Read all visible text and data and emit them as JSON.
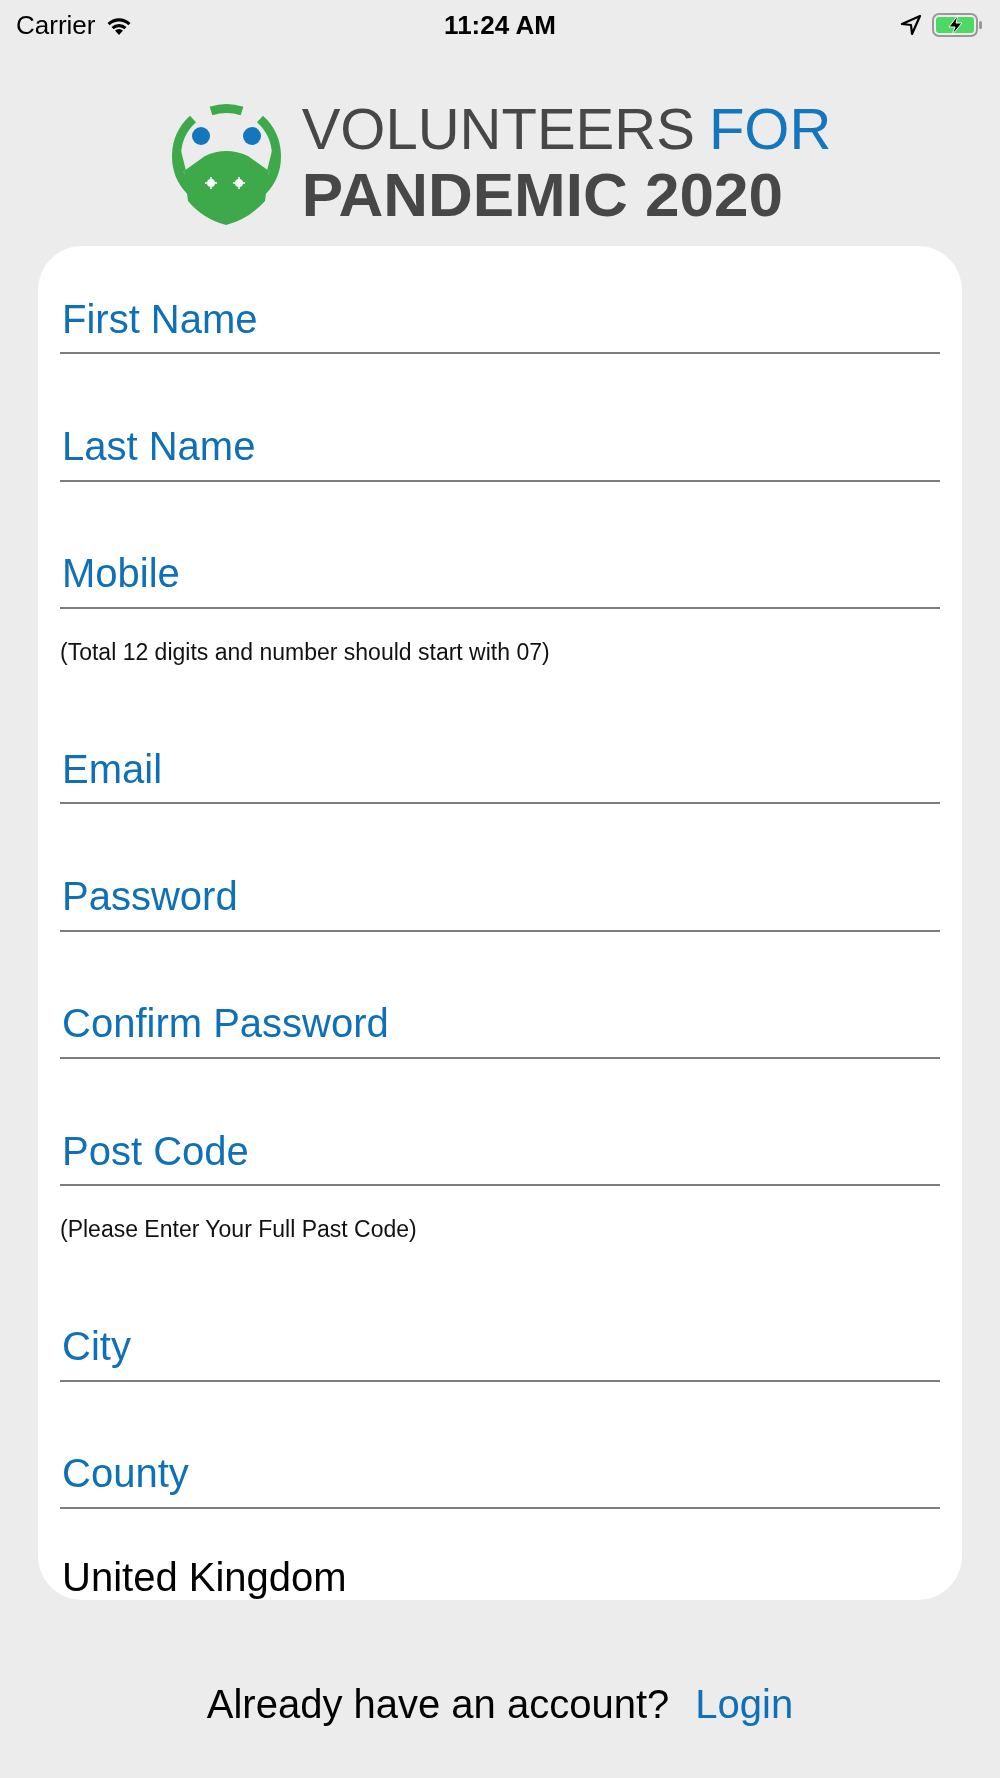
{
  "status_bar": {
    "carrier": "Carrier",
    "time": "11:24 AM"
  },
  "logo": {
    "line1": [
      {
        "text": "VOLUNTEERS",
        "accent": false
      },
      {
        "text": "FOR",
        "accent": true
      }
    ],
    "line2": "PANDEMIC 2020"
  },
  "form": {
    "items": [
      {
        "kind": "field",
        "placeholder": "First Name"
      },
      {
        "kind": "field",
        "placeholder": "Last Name"
      },
      {
        "kind": "field",
        "placeholder": "Mobile"
      },
      {
        "kind": "hint",
        "text": "(Total 12 digits and number should start with 07)"
      },
      {
        "kind": "field",
        "placeholder": "Email"
      },
      {
        "kind": "field",
        "placeholder": "Password"
      },
      {
        "kind": "field",
        "placeholder": "Confirm Password"
      },
      {
        "kind": "field",
        "placeholder": "Post Code"
      },
      {
        "kind": "hint",
        "text": "(Please Enter Your Full Past Code)"
      },
      {
        "kind": "field",
        "placeholder": "City"
      },
      {
        "kind": "field",
        "placeholder": "County"
      },
      {
        "kind": "value",
        "value": "United Kingdom"
      }
    ]
  },
  "footer": {
    "question": "Already have an account?",
    "link": "Login"
  }
}
